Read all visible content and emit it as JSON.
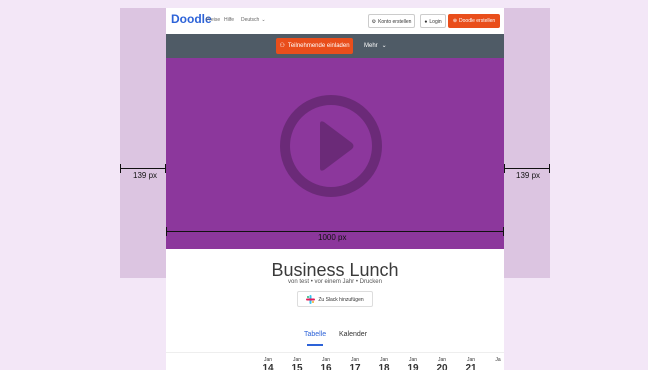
{
  "header": {
    "logo": "Doodle",
    "nav": [
      "Preise",
      "Hilfe",
      "Deutsch"
    ],
    "buttons": {
      "create_account": "Konto erstellen",
      "login": "Login",
      "create_doodle": "Doodle erstellen"
    }
  },
  "toolbar": {
    "invite_label": "Teilnehmende einladen",
    "more_label": "Mehr"
  },
  "event": {
    "title": "Business Lunch",
    "meta": "von test • vor einem Jahr • Drucken",
    "slack_label": "Zu Slack hinzufügen"
  },
  "tabs": {
    "table": "Tabelle",
    "calendar": "Kalender"
  },
  "dates": [
    {
      "month": "Jan",
      "day": "14"
    },
    {
      "month": "Jan",
      "day": "15"
    },
    {
      "month": "Jan",
      "day": "16"
    },
    {
      "month": "Jan",
      "day": "17"
    },
    {
      "month": "Jan",
      "day": "18"
    },
    {
      "month": "Jan",
      "day": "19"
    },
    {
      "month": "Jan",
      "day": "20"
    },
    {
      "month": "Jan",
      "day": "21"
    },
    {
      "month": "Ja",
      "day": ""
    }
  ],
  "annotations": {
    "left_margin": "139 px",
    "right_margin": "139 px",
    "width": "1000 px"
  },
  "colors": {
    "brand_blue": "#2d63d8",
    "accent_orange": "#e94e1b",
    "video_purple": "#8c379c",
    "dark_bar": "#4f5b66"
  }
}
